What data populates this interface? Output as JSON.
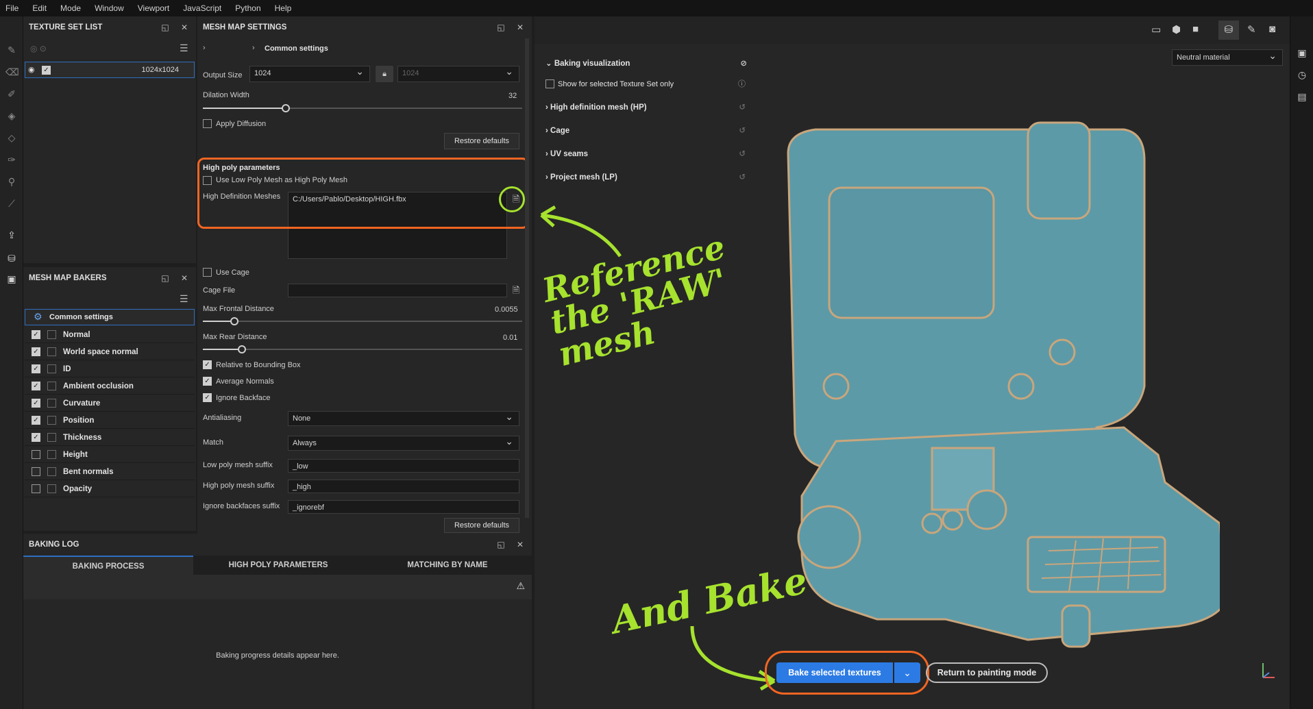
{
  "menu": [
    "File",
    "Edit",
    "Mode",
    "Window",
    "Viewport",
    "JavaScript",
    "Python",
    "Help"
  ],
  "texture_set_list": {
    "title": "TEXTURE SET LIST",
    "resolution": "1024x1024"
  },
  "mesh_map_bakers": {
    "title": "MESH MAP BAKERS",
    "common": "Common settings",
    "items": [
      {
        "label": "Normal",
        "checked": true
      },
      {
        "label": "World space normal",
        "checked": true
      },
      {
        "label": "ID",
        "checked": true
      },
      {
        "label": "Ambient occlusion",
        "checked": true
      },
      {
        "label": "Curvature",
        "checked": true
      },
      {
        "label": "Position",
        "checked": true
      },
      {
        "label": "Thickness",
        "checked": true
      },
      {
        "label": "Height",
        "checked": false
      },
      {
        "label": "Bent normals",
        "checked": false
      },
      {
        "label": "Opacity",
        "checked": false
      }
    ]
  },
  "mesh_map_settings": {
    "title": "MESH MAP SETTINGS",
    "section": "Common settings",
    "output_size_label": "Output Size",
    "output_size": "1024",
    "output_size_locked": "1024",
    "dilation_label": "Dilation Width",
    "dilation_value": "32",
    "apply_diffusion": "Apply Diffusion",
    "restore_defaults": "Restore defaults",
    "high_poly_title": "High poly parameters",
    "use_low_poly": "Use Low Poly Mesh as High Poly Mesh",
    "hd_meshes_label": "High Definition Meshes",
    "hd_meshes_value": "C:/Users/Pablo/Desktop/HIGH.fbx",
    "use_cage": "Use Cage",
    "cage_file": "Cage File",
    "max_frontal": "Max Frontal Distance",
    "max_frontal_value": "0.0055",
    "max_rear": "Max Rear Distance",
    "max_rear_value": "0.01",
    "relative_bbox": "Relative to Bounding Box",
    "average_normals": "Average Normals",
    "ignore_backface": "Ignore Backface",
    "antialiasing_label": "Antialiasing",
    "antialiasing": "None",
    "match_label": "Match",
    "match": "Always",
    "low_suffix_label": "Low poly mesh suffix",
    "low_suffix": "_low",
    "high_suffix_label": "High poly mesh suffix",
    "high_suffix": "_high",
    "ignore_suffix_label": "Ignore backfaces suffix",
    "ignore_suffix": "_ignorebf",
    "restore_defaults_2": "Restore defaults"
  },
  "baking_log": {
    "title": "BAKING LOG",
    "tabs": [
      "BAKING PROCESS",
      "HIGH POLY PARAMETERS",
      "MATCHING BY NAME"
    ],
    "message": "Baking progress details appear here."
  },
  "viewport": {
    "material": "Neutral material",
    "bake_vis_title": "Baking visualization",
    "show_selected": "Show for selected Texture Set only",
    "sections": [
      "High definition mesh (HP)",
      "Cage",
      "UV seams",
      "Project mesh (LP)"
    ],
    "bake_button": "Bake selected textures",
    "return_button": "Return to painting mode"
  },
  "annotations": {
    "reference": "Reference the 'RAW' mesh",
    "bake": "And Bake",
    "color": "#a6e22e",
    "highlight": "#f26522"
  }
}
